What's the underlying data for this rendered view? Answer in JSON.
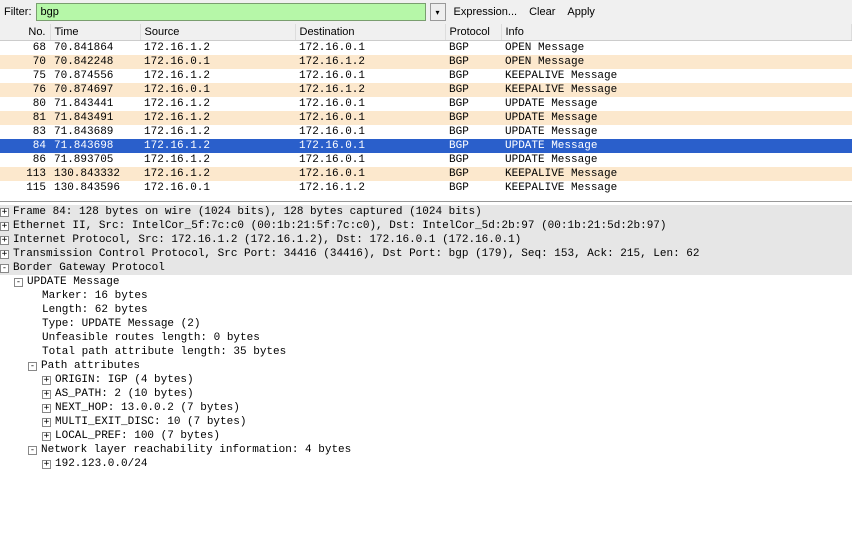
{
  "toolbar": {
    "filter_label": "Filter:",
    "filter_value": "bgp",
    "expression_label": "Expression...",
    "clear_label": "Clear",
    "apply_label": "Apply"
  },
  "columns": {
    "no": "No.",
    "time": "Time",
    "source": "Source",
    "destination": "Destination",
    "protocol": "Protocol",
    "info": "Info"
  },
  "packets": [
    {
      "no": "68",
      "time": "70.841864",
      "src": "172.16.1.2",
      "dst": "172.16.0.1",
      "proto": "BGP",
      "info": "OPEN Message",
      "sel": false
    },
    {
      "no": "70",
      "time": "70.842248",
      "src": "172.16.0.1",
      "dst": "172.16.1.2",
      "proto": "BGP",
      "info": "OPEN Message",
      "sel": false
    },
    {
      "no": "75",
      "time": "70.874556",
      "src": "172.16.1.2",
      "dst": "172.16.0.1",
      "proto": "BGP",
      "info": "KEEPALIVE Message",
      "sel": false
    },
    {
      "no": "76",
      "time": "70.874697",
      "src": "172.16.0.1",
      "dst": "172.16.1.2",
      "proto": "BGP",
      "info": "KEEPALIVE Message",
      "sel": false
    },
    {
      "no": "80",
      "time": "71.843441",
      "src": "172.16.1.2",
      "dst": "172.16.0.1",
      "proto": "BGP",
      "info": "UPDATE Message",
      "sel": false
    },
    {
      "no": "81",
      "time": "71.843491",
      "src": "172.16.1.2",
      "dst": "172.16.0.1",
      "proto": "BGP",
      "info": "UPDATE Message",
      "sel": false
    },
    {
      "no": "83",
      "time": "71.843689",
      "src": "172.16.1.2",
      "dst": "172.16.0.1",
      "proto": "BGP",
      "info": "UPDATE Message",
      "sel": false
    },
    {
      "no": "84",
      "time": "71.843698",
      "src": "172.16.1.2",
      "dst": "172.16.0.1",
      "proto": "BGP",
      "info": "UPDATE Message",
      "sel": true
    },
    {
      "no": "86",
      "time": "71.893705",
      "src": "172.16.1.2",
      "dst": "172.16.0.1",
      "proto": "BGP",
      "info": "UPDATE Message",
      "sel": false
    },
    {
      "no": "113",
      "time": "130.843332",
      "src": "172.16.1.2",
      "dst": "172.16.0.1",
      "proto": "BGP",
      "info": "KEEPALIVE Message",
      "sel": false
    },
    {
      "no": "115",
      "time": "130.843596",
      "src": "172.16.0.1",
      "dst": "172.16.1.2",
      "proto": "BGP",
      "info": "KEEPALIVE Message",
      "sel": false
    }
  ],
  "details": {
    "frame": "Frame 84: 128 bytes on wire (1024 bits), 128 bytes captured (1024 bits)",
    "eth": "Ethernet II, Src: IntelCor_5f:7c:c0 (00:1b:21:5f:7c:c0), Dst: IntelCor_5d:2b:97 (00:1b:21:5d:2b:97)",
    "ip": "Internet Protocol, Src: 172.16.1.2 (172.16.1.2), Dst: 172.16.0.1 (172.16.0.1)",
    "tcp": "Transmission Control Protocol, Src Port: 34416 (34416), Dst Port: bgp (179), Seq: 153, Ack: 215, Len: 62",
    "bgp": "Border Gateway Protocol",
    "update": "UPDATE Message",
    "marker": "Marker: 16 bytes",
    "length": "Length: 62 bytes",
    "type": "Type: UPDATE Message (2)",
    "unfeasible": "Unfeasible routes length: 0 bytes",
    "totalpath": "Total path attribute length: 35 bytes",
    "pathattr": "Path attributes",
    "origin": "ORIGIN: IGP (4 bytes)",
    "aspath": "AS_PATH: 2 (10 bytes)",
    "nexthop": "NEXT_HOP: 13.0.0.2 (7 bytes)",
    "med": "MULTI_EXIT_DISC: 10 (7 bytes)",
    "localpref": "LOCAL_PREF: 100 (7 bytes)",
    "nlri": "Network layer reachability information: 4 bytes",
    "prefix": "192.123.0.0/24"
  }
}
